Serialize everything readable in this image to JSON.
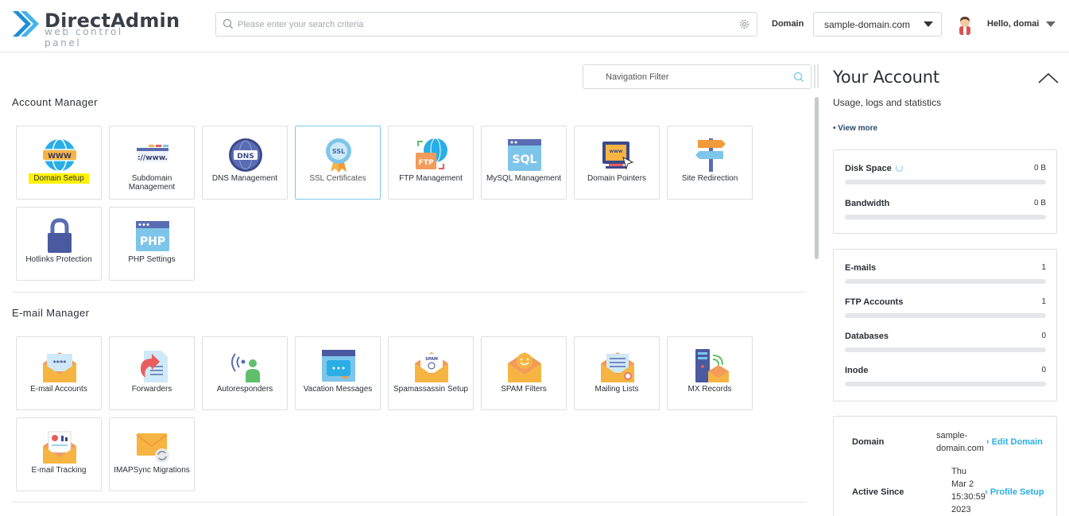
{
  "header": {
    "logo_title": "DirectAdmin",
    "logo_subtitle": "web control panel",
    "search_placeholder": "Please enter your search criteria",
    "domain_label": "Domain",
    "domain_value": "sample-domain.com",
    "greeting": "Hello, domai"
  },
  "main": {
    "nav_filter_label": "Navigation Filter",
    "sections": [
      {
        "title": "Account Manager",
        "items": [
          {
            "label": "Domain Setup",
            "icon": "globe-www-icon",
            "highlighted": true
          },
          {
            "label": "Subdomain Management",
            "icon": "subdomain-icon"
          },
          {
            "label": "DNS Management",
            "icon": "dns-globe-icon"
          },
          {
            "label": "SSL Certificates",
            "icon": "ssl-badge-icon",
            "active": true
          },
          {
            "label": "FTP Management",
            "icon": "ftp-folder-icon"
          },
          {
            "label": "MySQL Management",
            "icon": "sql-database-icon"
          },
          {
            "label": "Domain Pointers",
            "icon": "domain-pointer-icon"
          },
          {
            "label": "Site Redirection",
            "icon": "signpost-icon"
          },
          {
            "label": "Hotlinks Protection",
            "icon": "padlock-icon"
          },
          {
            "label": "PHP Settings",
            "icon": "php-window-icon"
          }
        ]
      },
      {
        "title": "E-mail Manager",
        "items": [
          {
            "label": "E-mail Accounts",
            "icon": "envelope-password-icon"
          },
          {
            "label": "Forwarders",
            "icon": "forward-arrow-icon"
          },
          {
            "label": "Autoresponders",
            "icon": "broadcast-person-icon"
          },
          {
            "label": "Vacation Messages",
            "icon": "vacation-window-icon"
          },
          {
            "label": "Spamassassin Setup",
            "icon": "spam-envelope-icon"
          },
          {
            "label": "SPAM Filters",
            "icon": "smiley-envelope-icon"
          },
          {
            "label": "Mailing Lists",
            "icon": "mailing-list-envelope-icon"
          },
          {
            "label": "MX Records",
            "icon": "server-mail-icon"
          },
          {
            "label": "E-mail Tracking",
            "icon": "email-tracking-icon"
          },
          {
            "label": "IMAPSync Migrations",
            "icon": "envelope-sync-icon"
          }
        ]
      }
    ]
  },
  "sidebar": {
    "title": "Your Account",
    "subtitle": "Usage, logs and statistics",
    "view_more": "• View more",
    "usage": [
      {
        "name": "Disk Space",
        "value": "0 B"
      },
      {
        "name": "Bandwidth",
        "value": "0 B"
      }
    ],
    "counts": [
      {
        "name": "E-mails",
        "value": "1"
      },
      {
        "name": "FTP Accounts",
        "value": "1"
      },
      {
        "name": "Databases",
        "value": "0"
      },
      {
        "name": "Inode",
        "value": "0"
      }
    ],
    "info": {
      "domain_label": "Domain",
      "domain_value_1": "sample-",
      "domain_value_2": "domain.com",
      "edit_domain": "› Edit Domain",
      "active_since_label": "Active Since",
      "active_since_1": "Thu",
      "active_since_2": "Mar 2",
      "active_since_3": "15:30:59",
      "active_since_4": "2023",
      "profile_setup": "› Profile Setup"
    }
  },
  "colors": {
    "accent": "#29aee6",
    "highlight": "#fff200",
    "logo_blue": "#1e8fd6"
  }
}
